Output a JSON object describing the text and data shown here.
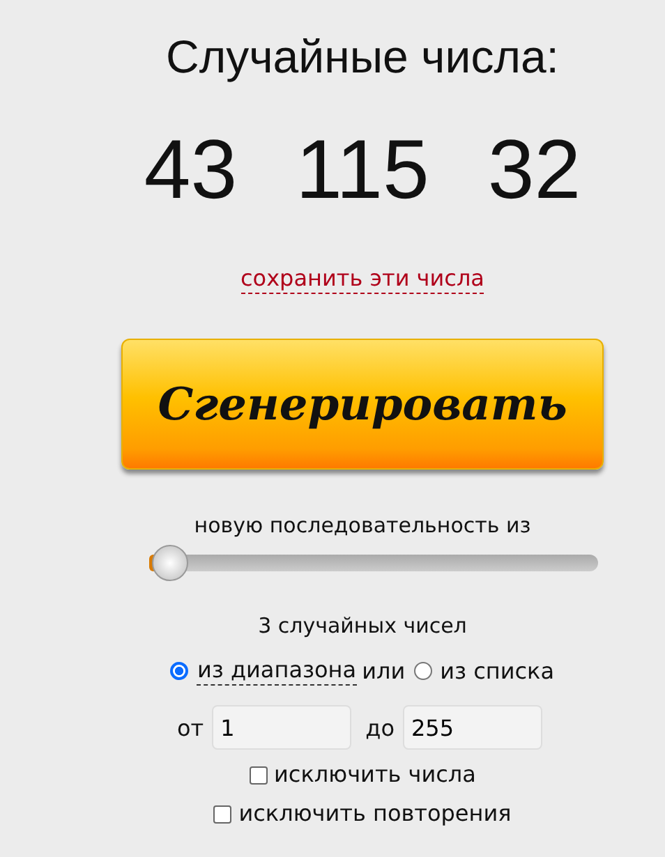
{
  "title": "Случайные числа:",
  "numbers": [
    "43",
    "115",
    "32"
  ],
  "save_link": "сохранить эти числа",
  "generate_button": "Сгенерировать",
  "sequence_label": "новую последовательность из",
  "count_slider": {
    "level": 0.02
  },
  "count_label": "3 случайных чисел",
  "source_options": [
    {
      "label": "из диапазона",
      "selected": true,
      "dotted": true
    },
    {
      "label": "из списка",
      "selected": false,
      "dotted": false
    }
  ],
  "source_joiner": "или",
  "range": {
    "from_label": "от",
    "from_value": "1",
    "to_label": "до",
    "to_value": "255"
  },
  "options": [
    {
      "label": "исключить числа",
      "checked": false
    },
    {
      "label": "исключить повторения",
      "checked": false
    }
  ]
}
